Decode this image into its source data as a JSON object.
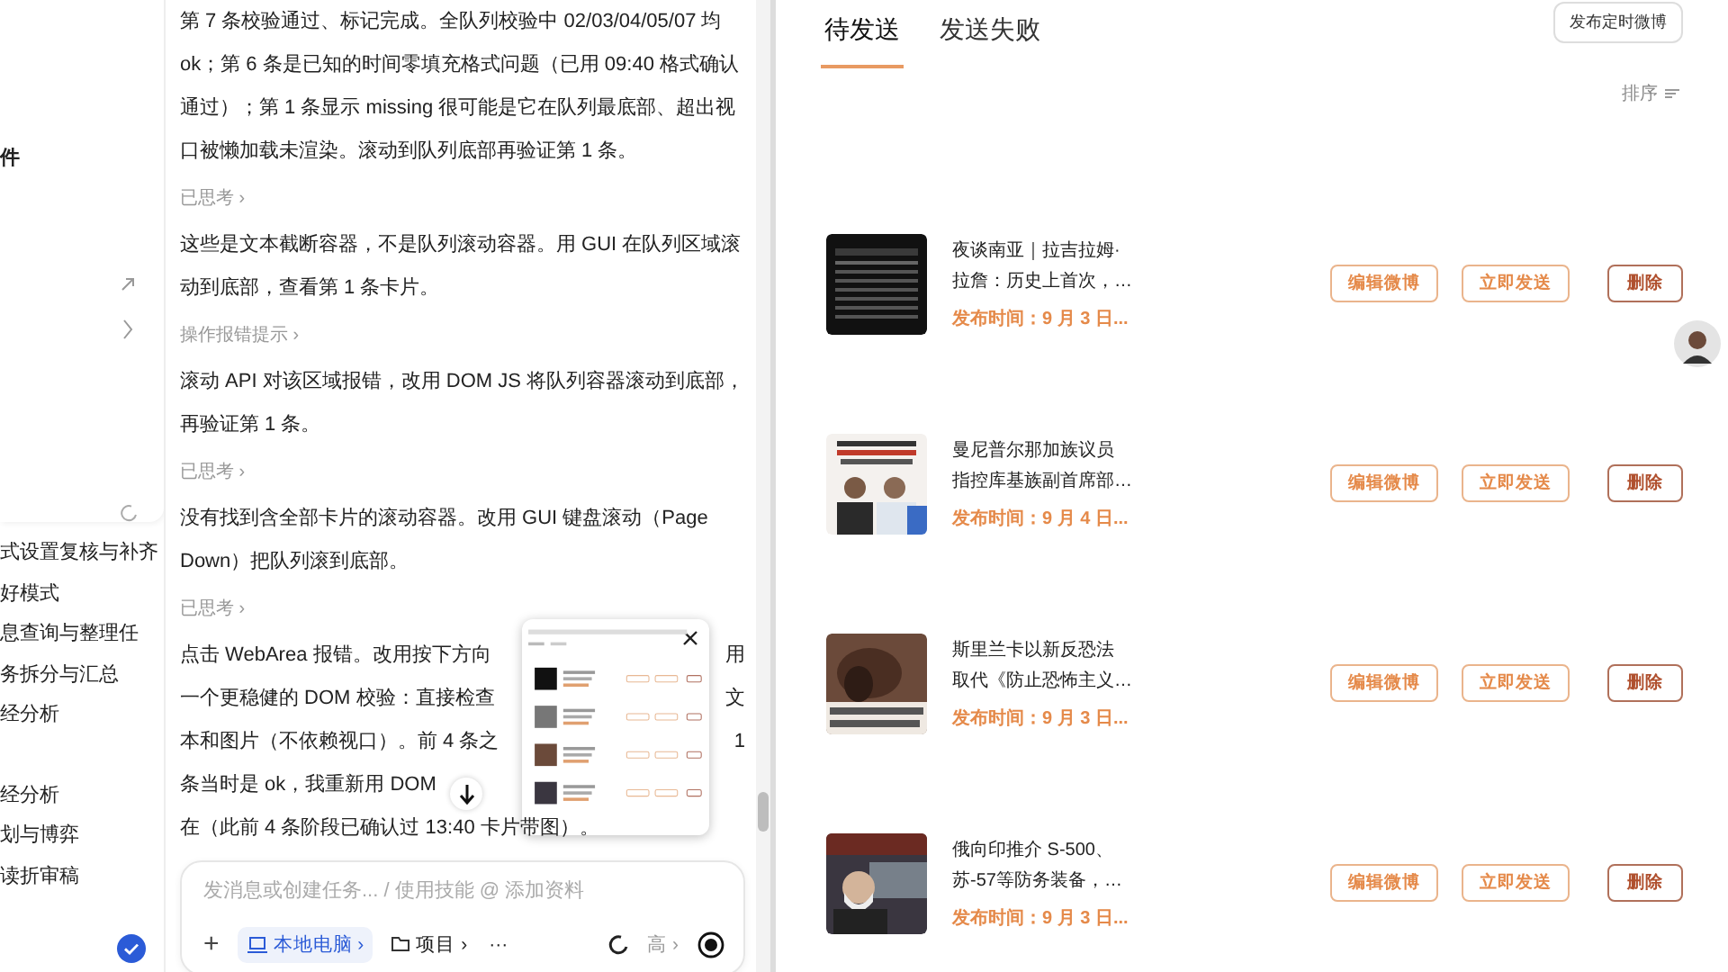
{
  "sidebar": {
    "header_item": "件",
    "items": [
      {
        "label": "式设置复核与补齐"
      },
      {
        "label": "好模式"
      },
      {
        "label": "息查询与整理任"
      },
      {
        "label": "务拆分与汇总"
      },
      {
        "label": "经分析"
      }
    ],
    "items_2": [
      {
        "label": "经分析"
      },
      {
        "label": "划与博弈"
      },
      {
        "label": "读折审稿"
      }
    ]
  },
  "chat": {
    "blocks": [
      {
        "kind": "text",
        "text": "第 7 条校验通过、标记完成。全队列校验中 02/03/04/05/07 均 ok；第 6 条是已知的时间零填充格式问题（已用 09:40 格式确认通过）；第 1 条显示 missing 很可能是它在队列最底部、超出视口被懒加载未渲染。滚动到队列底部再验证第 1 条。"
      },
      {
        "kind": "step",
        "text": "已思考 ›"
      },
      {
        "kind": "text",
        "text": "这些是文本截断容器，不是队列滚动容器。用 GUI 在队列区域滚动到底部，查看第 1 条卡片。"
      },
      {
        "kind": "step",
        "text": "操作报错提示 ›"
      },
      {
        "kind": "text",
        "text": "滚动 API 对该区域报错，改用 DOM JS 将队列容器滚动到底部，再验证第 1 条。"
      },
      {
        "kind": "step",
        "text": "已思考 ›"
      },
      {
        "kind": "text",
        "text": "没有找到含全部卡片的滚动容器。改用 GUI 键盘滚动（Page Down）把队列滚到底部。"
      },
      {
        "kind": "step",
        "text": "已思考 ›"
      }
    ],
    "covered_lines": [
      {
        "text": "点击 WebArea 报错。改用按下方向",
        "tail": "用"
      },
      {
        "text": "一个更稳健的 DOM 校验：直接检查",
        "tail": "文"
      },
      {
        "text": "本和图片（不依赖视口）。前 4 条之",
        "tail": "1"
      },
      {
        "text": "条当时是 ok，我重新用 DOM"
      }
    ],
    "last_line": "在（此前 4 条阶段已确认过 13:40 卡片带图）。",
    "composer": {
      "placeholder": "发消息或创建任务... / 使用技能 @ 添加资料",
      "plus": "+",
      "device": "本地电脑 ›",
      "project": "项目 ›",
      "more": "···",
      "level": "高 ›"
    }
  },
  "panel": {
    "tabs": [
      {
        "label": "待发送",
        "selected": true
      },
      {
        "label": "发送失败",
        "selected": false
      }
    ],
    "publish_button": "发布定时微博",
    "sort": "排序",
    "posts": [
      {
        "title_lines": [
          "夜谈南亚｜拉吉拉姆·",
          "拉詹：历史上首次，…"
        ],
        "time": "发布时间：9 月 3 日...",
        "edit": "编辑微博",
        "send": "立即发送",
        "delete": "删除"
      },
      {
        "title_lines": [
          "曼尼普尔那加族议员",
          "指控库基族副首席部…"
        ],
        "time": "发布时间：9 月 4 日...",
        "edit": "编辑微博",
        "send": "立即发送",
        "delete": "删除"
      },
      {
        "title_lines": [
          "斯里兰卡以新反恐法",
          "取代《防止恐怖主义…"
        ],
        "time": "发布时间：9 月 3 日...",
        "edit": "编辑微博",
        "send": "立即发送",
        "delete": "删除"
      },
      {
        "title_lines": [
          "俄向印推介 S-500、",
          "苏-57等防务装备，…"
        ],
        "time": "发布时间：9 月 3 日...",
        "edit": "编辑微博",
        "send": "立即发送",
        "delete": "删除"
      }
    ]
  }
}
